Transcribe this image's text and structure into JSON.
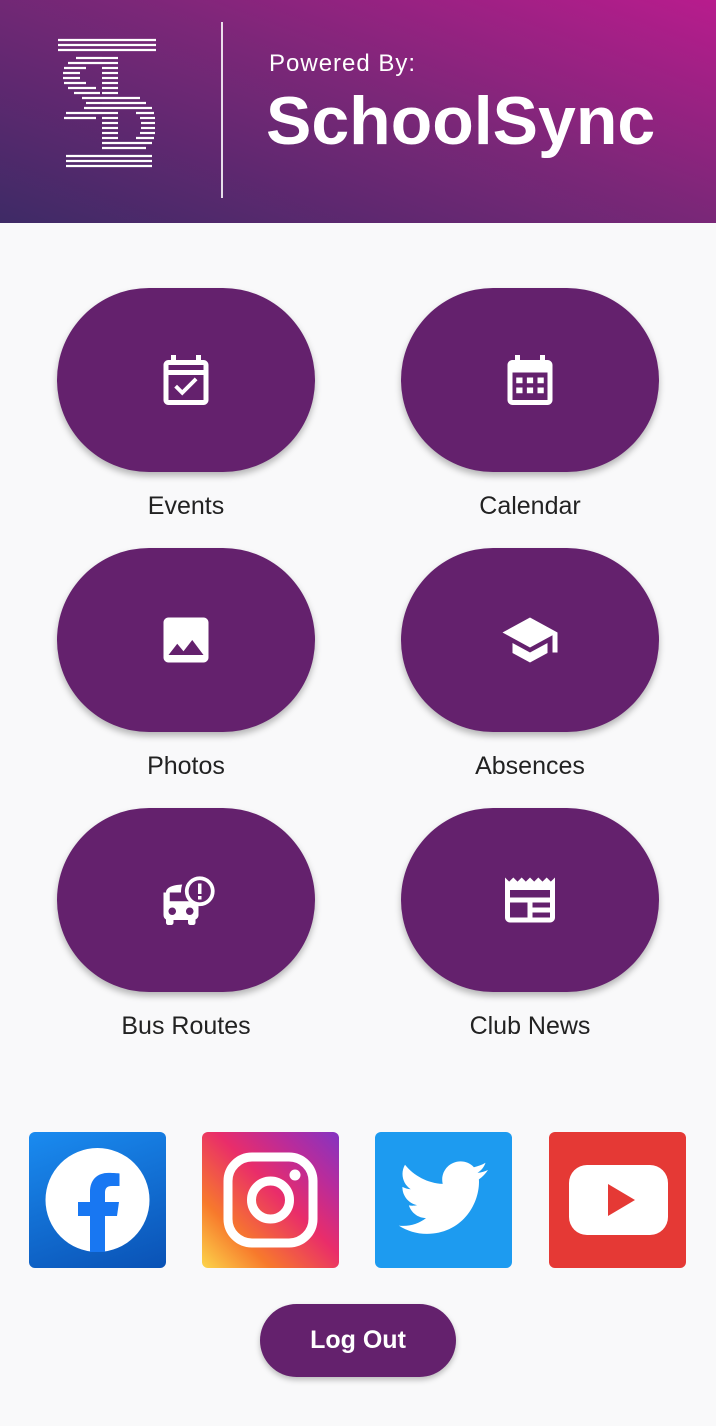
{
  "header": {
    "powered_by": "Powered By:",
    "brand": "SchoolSync"
  },
  "menu": {
    "items": [
      {
        "label": "Events",
        "icon": "calendar-check-icon"
      },
      {
        "label": "Calendar",
        "icon": "calendar-grid-icon"
      },
      {
        "label": "Photos",
        "icon": "image-icon"
      },
      {
        "label": "Absences",
        "icon": "graduation-cap-icon"
      },
      {
        "label": "Bus Routes",
        "icon": "bus-alert-icon"
      },
      {
        "label": "Club News",
        "icon": "newspaper-icon"
      }
    ]
  },
  "social": [
    {
      "icon": "facebook-icon"
    },
    {
      "icon": "instagram-icon"
    },
    {
      "icon": "twitter-icon"
    },
    {
      "icon": "youtube-icon"
    }
  ],
  "logout_label": "Log Out",
  "colors": {
    "primary": "#64216d",
    "header_start": "#b81c8d",
    "header_end": "#3e2a66",
    "background": "#f9f9fa"
  }
}
